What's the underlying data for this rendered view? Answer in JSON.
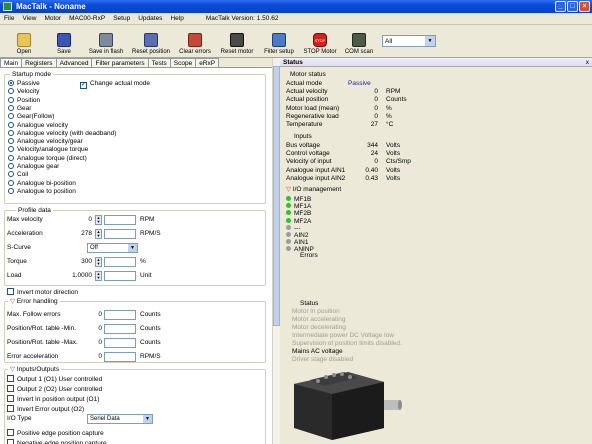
{
  "window": {
    "title": "MacTalk - Noname"
  },
  "menu": {
    "items": [
      "File",
      "View",
      "Motor",
      "MAC00-RxP",
      "Setup",
      "Updates",
      "Help"
    ],
    "version": "MacTalk Version: 1.50.62"
  },
  "toolbar": {
    "buttons": [
      "Open",
      "Save",
      "Save in flash",
      "Reset position",
      "Clear errors",
      "Reset motor",
      "Filter setup",
      "STOP Motor",
      "COM scan"
    ],
    "icons": [
      "open-folder-icon",
      "save-disk-icon",
      "save-flash-icon",
      "reset-position-icon",
      "clear-errors-icon",
      "reset-motor-icon",
      "filter-setup-icon",
      "stop-sign-icon",
      "com-scan-icon"
    ],
    "select_value": "All"
  },
  "tabs": [
    "Main",
    "Registers",
    "Advanced",
    "Filter parameters",
    "Tests",
    "Scope",
    "eRxP"
  ],
  "startup": {
    "title": "Startup mode",
    "modes": [
      "Passive",
      "Velocity",
      "Position",
      "Gear",
      "Gear(Follow)",
      "Analogue velocity",
      "Analogue velocity (with deadband)",
      "Analogue velocity/gear",
      "Velocity/analogue torque",
      "Analogue torque (direct)",
      "Analogue gear",
      "Coil",
      "Analogue bi-position",
      "Analogue to position"
    ],
    "selected": 0,
    "change_label": "Change actual mode"
  },
  "profile": {
    "title": "Profile data",
    "max_velocity_label": "Max velocity",
    "max_velocity": "0",
    "max_velocity_unit": "RPM",
    "accel_label": "Acceleration",
    "accel": "278",
    "accel_unit": "RPM/S",
    "scurve_label": "S-Curve",
    "scurve": "Off",
    "torque_label": "Torque",
    "torque": "300",
    "torque_unit": "%",
    "load_label": "Load",
    "load": "1.0000",
    "load_unit": "Unit",
    "invert_label": "Invert motor direction"
  },
  "errhandling": {
    "title": "Error handling",
    "rows": [
      {
        "label": "Max. Follow errors",
        "value": "0",
        "unit": "Counts"
      },
      {
        "label": "Position/Rot. table -Min.",
        "value": "0",
        "unit": "Counts"
      },
      {
        "label": "Position/Rot. table -Max.",
        "value": "0",
        "unit": "Counts"
      },
      {
        "label": "Error acceleration",
        "value": "0",
        "unit": "RPM/S"
      }
    ]
  },
  "io": {
    "title": "Inputs/Outputs",
    "checks": [
      "Output 1 (O1) User controlled",
      "Output 2 (O2) User controlled",
      "Invert In position output (O1)",
      "Invert Error output (O2)"
    ],
    "io_type_label": "I/O Type",
    "io_type": "Seriel Data",
    "checks2": [
      "Positive edge position capture",
      "Negative edge position capture"
    ]
  },
  "status": {
    "header": "Status",
    "close": "x",
    "motor_title": "Motor status",
    "motor_rows": [
      {
        "label": "Actual mode",
        "value": "Passive",
        "unit": ""
      },
      {
        "label": "Actual velocity",
        "value": "0",
        "unit": "RPM"
      },
      {
        "label": "Actual position",
        "value": "0",
        "unit": "Counts"
      },
      {
        "label": "Motor load (mean)",
        "value": "0",
        "unit": "%"
      },
      {
        "label": "Regenerative load",
        "value": "0",
        "unit": "%"
      },
      {
        "label": "Temperature",
        "value": "27",
        "unit": "°C"
      }
    ],
    "inputs_title": "Inputs",
    "input_rows": [
      {
        "label": "Bus voltage",
        "value": "344",
        "unit": "Volts"
      },
      {
        "label": "Control voltage",
        "value": "24",
        "unit": "Volts"
      },
      {
        "label": "Velocity of input",
        "value": "0",
        "unit": "Cts/Smp"
      },
      {
        "label": "Analogue input AIN1",
        "value": "0.40",
        "unit": "Volts"
      },
      {
        "label": "Analogue input AIN2",
        "value": "0.43",
        "unit": "Volts"
      }
    ],
    "io_title": "I/O management",
    "io_items": [
      {
        "label": "MF1B",
        "color": "#2fbf2f"
      },
      {
        "label": "MF1A",
        "color": "#2fbf2f"
      },
      {
        "label": "MF2B",
        "color": "#2fbf2f"
      },
      {
        "label": "MF2A",
        "color": "#2fbf2f"
      },
      {
        "label": "---",
        "color": "#9c9c9c"
      },
      {
        "label": "AIN2",
        "color": "#9c9c9c"
      },
      {
        "label": "AIN1",
        "color": "#9c9c9c"
      },
      {
        "label": "ANINP",
        "color": "#9c9c9c"
      }
    ],
    "errors_title": "Errors",
    "status_title": "Status",
    "status_items": [
      "Motor in position",
      "Motor accelerating",
      "Motor decelerating",
      "Intermediate power DC Voltage low",
      "Supervision of position limits disabled.",
      "Mains AC voltage",
      "Driver stage disabled"
    ],
    "status_active": [
      false,
      false,
      false,
      false,
      false,
      true,
      false
    ]
  },
  "colors": {
    "accent": "#0843c4",
    "passive": "#1a1ab8"
  }
}
